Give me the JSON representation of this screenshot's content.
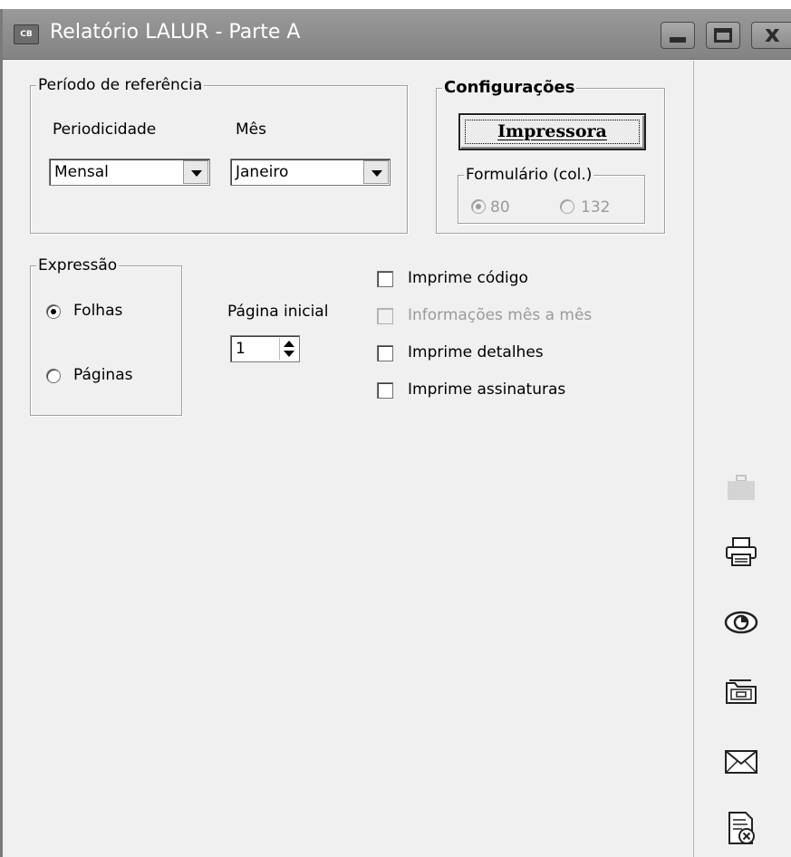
{
  "window": {
    "icon_label": "CB",
    "title": "Relatório LALUR - Parte A",
    "minimize_icon": "minimize-icon",
    "maximize_icon": "maximize-icon",
    "close_icon": "close-icon"
  },
  "periodo": {
    "legend": "Período de referência",
    "periodicidade_label": "Periodicidade",
    "periodicidade_value": "Mensal",
    "mes_label": "Mês",
    "mes_value": "Janeiro"
  },
  "configuracoes": {
    "legend": "Configurações",
    "printer_button": "Impressora",
    "formulario_legend": "Formulário (col.)",
    "options": [
      {
        "label": "80",
        "selected": true,
        "enabled": false
      },
      {
        "label": "132",
        "selected": false,
        "enabled": false
      }
    ]
  },
  "expressao": {
    "legend": "Expressão",
    "options": [
      {
        "label": "Folhas",
        "selected": true
      },
      {
        "label": "Páginas",
        "selected": false
      }
    ]
  },
  "pagina_inicial": {
    "label": "Página inicial",
    "value": "1"
  },
  "checkboxes": [
    {
      "label": "Imprime código",
      "checked": false,
      "enabled": true
    },
    {
      "label": "Informações mês a mês",
      "checked": false,
      "enabled": false
    },
    {
      "label": "Imprime detalhes",
      "checked": false,
      "enabled": true
    },
    {
      "label": "Imprime assinaturas",
      "checked": false,
      "enabled": true
    }
  ],
  "side_actions": [
    {
      "icon": "briefcase-icon",
      "enabled": false
    },
    {
      "icon": "printer-icon",
      "enabled": true
    },
    {
      "icon": "eye-icon",
      "enabled": true
    },
    {
      "icon": "folder-export-icon",
      "enabled": true
    },
    {
      "icon": "envelope-icon",
      "enabled": true
    },
    {
      "icon": "document-cancel-icon",
      "enabled": true
    }
  ]
}
